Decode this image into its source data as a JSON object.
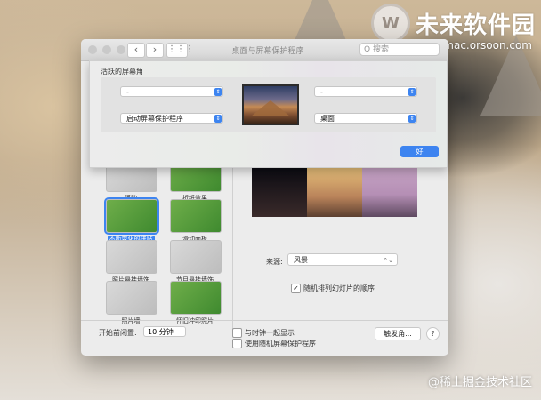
{
  "watermark": {
    "logo_char": "W",
    "title": "未来软件园",
    "url": "mac.orsoon.com",
    "bottom_credit": "@稀土掘金技术社区"
  },
  "window": {
    "title": "桌面与屏幕保护程序",
    "search_placeholder": "Q 搜索"
  },
  "hot_corners": {
    "title": "活跃的屏幕角",
    "top_left": "-",
    "top_right": "-",
    "bottom_left": "启动屏幕保护程序",
    "bottom_right": "桌面",
    "ok_label": "好"
  },
  "screen_savers": [
    {
      "label": "浮动",
      "style": "gray"
    },
    {
      "label": "折纸效果",
      "style": "green"
    },
    {
      "label": "不断变化的拼贴",
      "style": "green",
      "selected": true
    },
    {
      "label": "滑动面板",
      "style": "green"
    },
    {
      "label": "照片悬挂墙饰",
      "style": "gray"
    },
    {
      "label": "节目悬挂墙饰",
      "style": "gray"
    },
    {
      "label": "照片墙",
      "style": "gray"
    },
    {
      "label": "怀旧冲印照片",
      "style": "green"
    }
  ],
  "options": {
    "source_label": "来源:",
    "source_value": "风景",
    "shuffle_label": "随机排列幻灯片的顺序",
    "shuffle_checked": true
  },
  "bottom": {
    "idle_label": "开始前闲置:",
    "idle_value": "10 分钟",
    "clock_label": "与时钟一起显示",
    "random_label": "使用随机屏幕保护程序",
    "hot_corners_button": "触发角...",
    "help_label": "?"
  }
}
